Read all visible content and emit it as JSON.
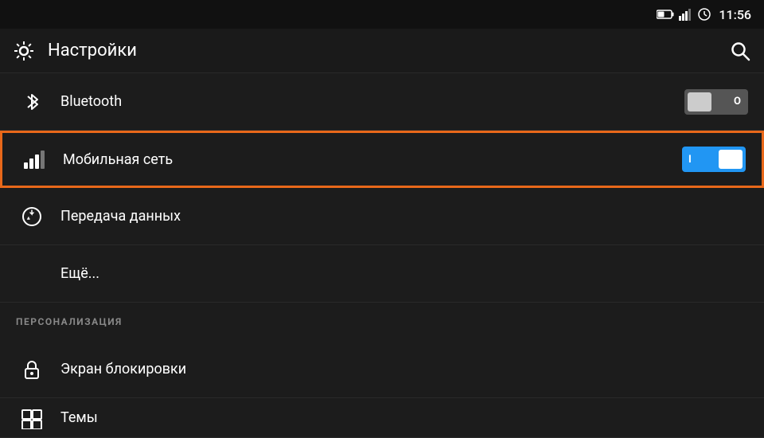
{
  "statusBar": {
    "time": "11:56",
    "icons": [
      "battery",
      "signal",
      "clock"
    ]
  },
  "topBar": {
    "title": "Настройки",
    "searchLabel": "Поиск"
  },
  "settings": {
    "items": [
      {
        "id": "bluetooth",
        "icon": "bluetooth-icon",
        "label": "Bluetooth",
        "toggle": true,
        "toggleState": "off",
        "highlighted": false
      },
      {
        "id": "mobile-network",
        "icon": "signal-icon",
        "label": "Мобильная сеть",
        "toggle": true,
        "toggleState": "on",
        "highlighted": true
      },
      {
        "id": "data-transfer",
        "icon": "data-icon",
        "label": "Передача данных",
        "toggle": false,
        "highlighted": false
      },
      {
        "id": "more",
        "icon": null,
        "label": "Ещё...",
        "toggle": false,
        "indent": true,
        "highlighted": false
      }
    ],
    "sections": [
      {
        "id": "personalization",
        "label": "ПЕРСОНАЛИЗАЦИЯ",
        "items": [
          {
            "id": "lock-screen",
            "icon": "lock-icon",
            "label": "Экран блокировки",
            "toggle": false
          },
          {
            "id": "themes",
            "icon": "themes-icon",
            "label": "Темы",
            "toggle": false
          }
        ]
      }
    ],
    "toggleLabels": {
      "on": "I",
      "off": "O"
    }
  }
}
